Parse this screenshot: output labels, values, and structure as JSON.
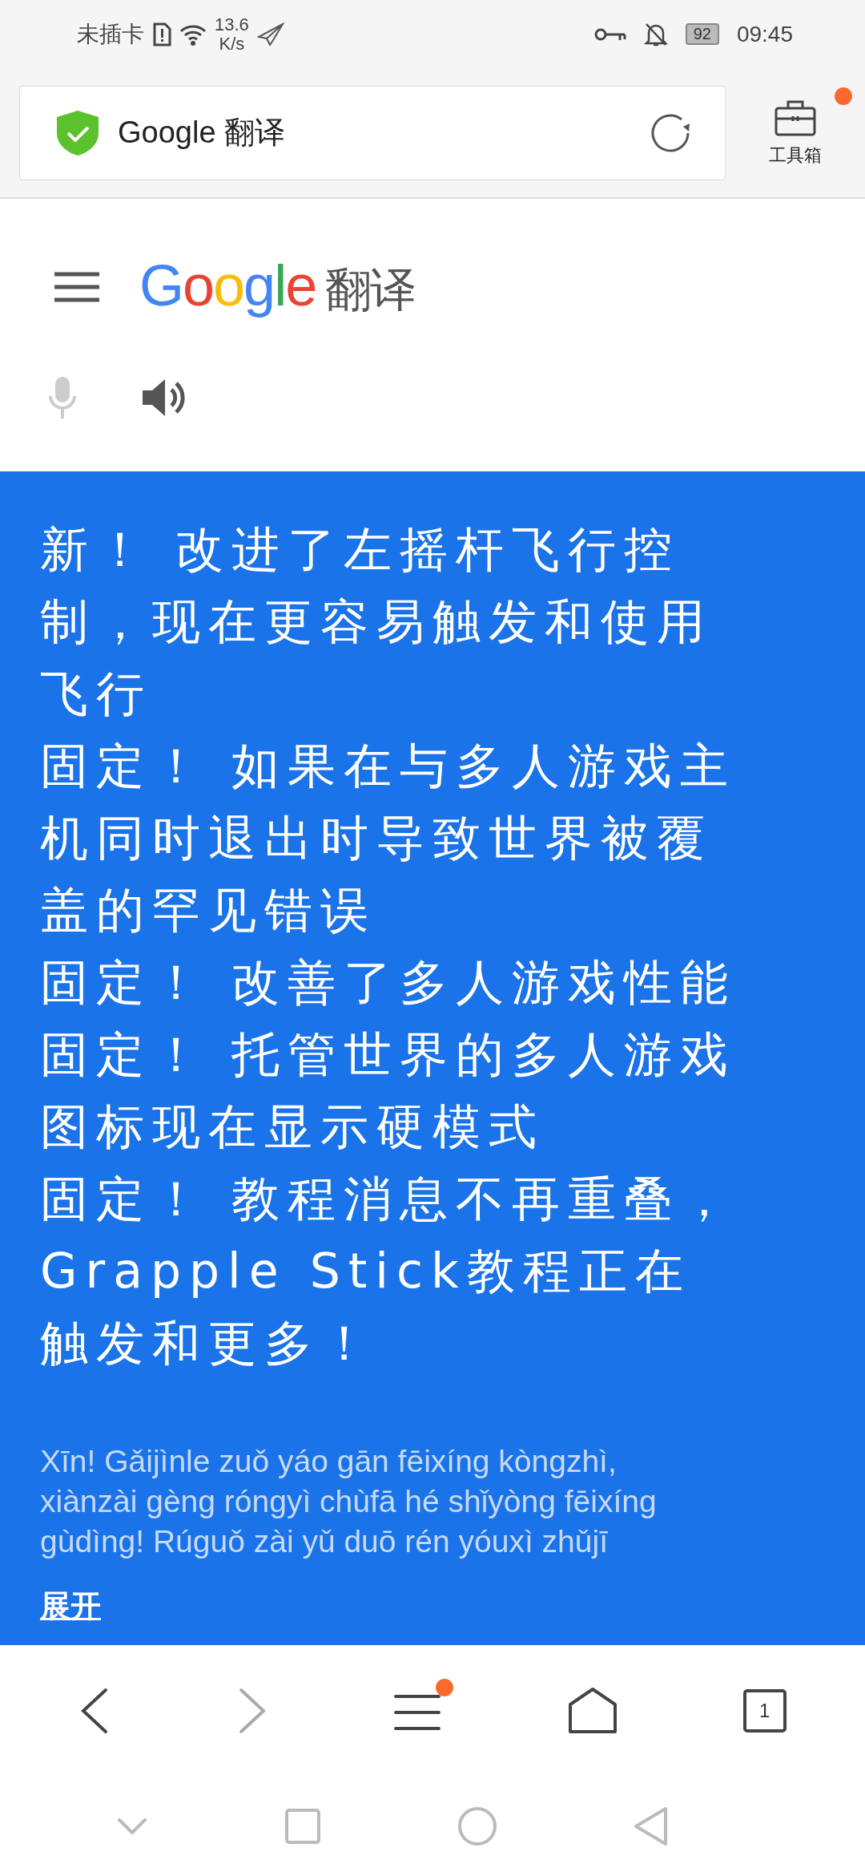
{
  "status_bar": {
    "carrier": "未插卡",
    "speed_value": "13.6",
    "speed_unit": "K/s",
    "battery": "92",
    "time": "09:45"
  },
  "address_bar": {
    "title": "Google 翻译",
    "secure": true
  },
  "toolbox": {
    "label": "工具箱",
    "badge": true
  },
  "header": {
    "logo_letters": [
      {
        "char": "G",
        "color": "#4285f4"
      },
      {
        "char": "o",
        "color": "#ea4335"
      },
      {
        "char": "o",
        "color": "#fbbc05"
      },
      {
        "char": "g",
        "color": "#4285f4"
      },
      {
        "char": "l",
        "color": "#34a853"
      },
      {
        "char": "e",
        "color": "#ea4335"
      }
    ],
    "logo_suffix": "翻译"
  },
  "voice": {
    "mic_disabled": true
  },
  "translation": {
    "lines": [
      "新！ 改进了左摇杆飞行控制，现在更容易触发和使用飞行",
      "固定！ 如果在与多人游戏主机同时退出时导致世界被覆盖的罕见错误",
      "固定！ 改善了多人游戏性能",
      "固定！ 托管世界的多人游戏图标现在显示硬模式",
      "固定！ 教程消息不再重叠，Grapple Stick教程正在触发和更多！"
    ],
    "romanization": [
      "Xīn! Gǎijìnle zuǒ yáo gān fēixíng kòngzhì,",
      "xiànzài gèng róngyì chùfā hé shǐyòng fēixíng",
      "gùdìng! Rúguǒ zài yǔ duō rén yóuxì zhǔjī"
    ],
    "expand": "展开"
  },
  "bottom_nav": {
    "back_enabled": true,
    "forward_enabled": false,
    "menu_badge": true,
    "tab_count": "1"
  }
}
